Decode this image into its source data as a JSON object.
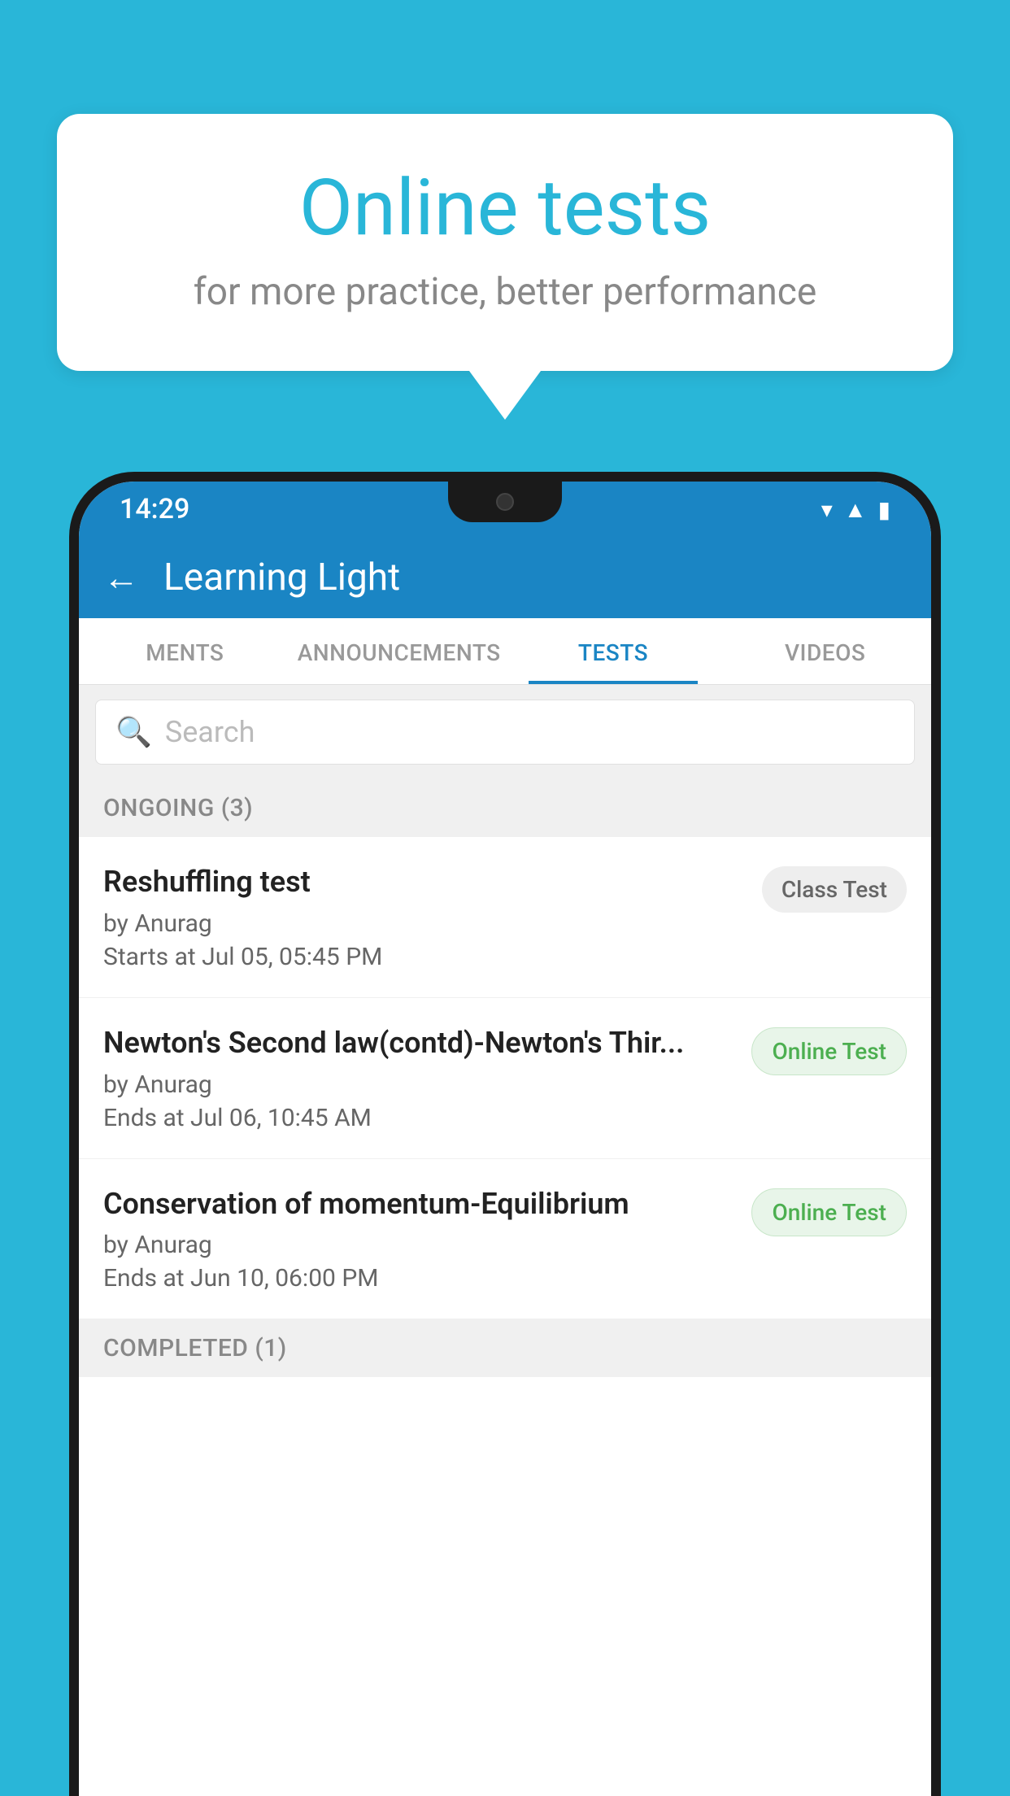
{
  "background": {
    "color": "#29b6d8"
  },
  "speech_bubble": {
    "title": "Online tests",
    "subtitle": "for more practice, better performance"
  },
  "status_bar": {
    "time": "14:29",
    "icons": [
      "wifi",
      "signal",
      "battery"
    ]
  },
  "app_header": {
    "title": "Learning Light",
    "back_label": "←"
  },
  "tabs": [
    {
      "label": "MENTS",
      "active": false
    },
    {
      "label": "ANNOUNCEMENTS",
      "active": false
    },
    {
      "label": "TESTS",
      "active": true
    },
    {
      "label": "VIDEOS",
      "active": false
    }
  ],
  "search": {
    "placeholder": "Search"
  },
  "ongoing_section": {
    "label": "ONGOING (3)"
  },
  "tests": [
    {
      "name": "Reshuffling test",
      "author": "by Anurag",
      "date": "Starts at  Jul 05, 05:45 PM",
      "badge": "Class Test",
      "badge_type": "class"
    },
    {
      "name": "Newton's Second law(contd)-Newton's Thir...",
      "author": "by Anurag",
      "date": "Ends at  Jul 06, 10:45 AM",
      "badge": "Online Test",
      "badge_type": "online"
    },
    {
      "name": "Conservation of momentum-Equilibrium",
      "author": "by Anurag",
      "date": "Ends at  Jun 10, 06:00 PM",
      "badge": "Online Test",
      "badge_type": "online"
    }
  ],
  "completed_section": {
    "label": "COMPLETED (1)"
  }
}
